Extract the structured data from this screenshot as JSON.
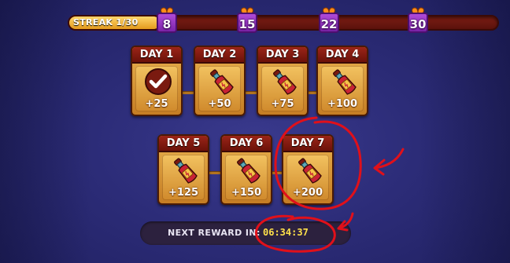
{
  "streak": {
    "label": "STREAK  1/30",
    "current": 1,
    "total": 30,
    "milestones": [
      {
        "value": "8",
        "icon": "gift-icon"
      },
      {
        "value": "15",
        "icon": "gift-icon"
      },
      {
        "value": "22",
        "icon": "gift-icon"
      },
      {
        "value": "30",
        "icon": "gift-icon"
      }
    ]
  },
  "days": [
    {
      "label": "DAY 1",
      "reward": "+25",
      "icon": "checkmark-icon",
      "claimed": true
    },
    {
      "label": "DAY 2",
      "reward": "+50",
      "icon": "potion-bottle-icon",
      "claimed": false
    },
    {
      "label": "DAY 3",
      "reward": "+75",
      "icon": "potion-bottle-icon",
      "claimed": false
    },
    {
      "label": "DAY 4",
      "reward": "+100",
      "icon": "potion-bottle-icon",
      "claimed": false
    },
    {
      "label": "DAY 5",
      "reward": "+125",
      "icon": "potion-bottle-icon",
      "claimed": false
    },
    {
      "label": "DAY 6",
      "reward": "+150",
      "icon": "potion-bottle-icon",
      "claimed": false
    },
    {
      "label": "DAY 7",
      "reward": "+200",
      "icon": "potion-bottle-icon",
      "claimed": false
    }
  ],
  "next_reward": {
    "label": "NEXT REWARD IN:",
    "timer": "06:34:37"
  },
  "colors": {
    "background": "#2c2c78",
    "card_header": "#8a1e12",
    "card_body": "#e3a545",
    "timer": "#ffe14a",
    "annotation_red": "#e0101a"
  }
}
